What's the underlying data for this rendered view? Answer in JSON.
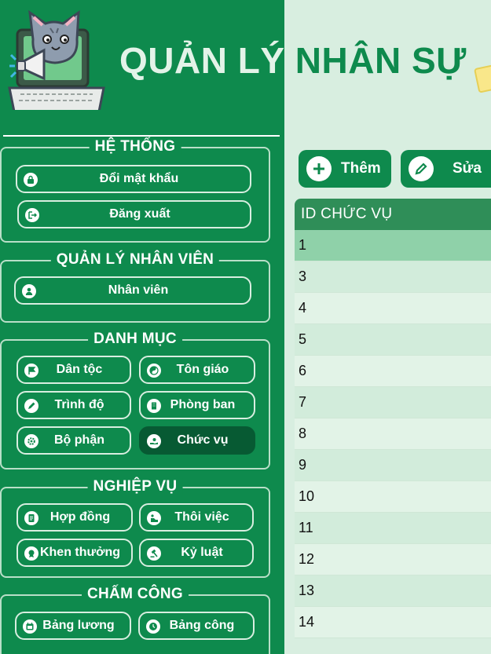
{
  "header": {
    "title_part1": "QUẢN LÝ",
    "title_part2": "NHÂN SỰ"
  },
  "sidebar": {
    "he_thong": {
      "title": "HỆ THỐNG",
      "buttons": [
        "Đổi mật khẩu",
        "Đăng xuất"
      ]
    },
    "quan_ly_nhan_vien": {
      "title": "QUẢN LÝ NHÂN VIÊN",
      "buttons": [
        "Nhân viên"
      ]
    },
    "danh_muc": {
      "title": "DANH MỤC",
      "buttons": [
        "Dân tộc",
        "Tôn giáo",
        "Trình độ",
        "Phòng ban",
        "Bộ phận",
        "Chức vụ"
      ]
    },
    "nghiep_vu": {
      "title": "NGHIỆP VỤ",
      "buttons": [
        "Hợp đồng",
        "Thôi việc",
        "Khen thưởng",
        "Kỷ luật"
      ]
    },
    "cham_cong": {
      "title": "CHẤM CÔNG",
      "buttons": [
        "Bảng lương",
        "Bảng công"
      ]
    }
  },
  "toolbar": {
    "add_label": "Thêm",
    "edit_label": "Sửa"
  },
  "table": {
    "header": "ID CHỨC VỤ",
    "rows": [
      "1",
      "3",
      "4",
      "5",
      "6",
      "7",
      "8",
      "9",
      "10",
      "11",
      "12",
      "13",
      "14"
    ]
  }
}
